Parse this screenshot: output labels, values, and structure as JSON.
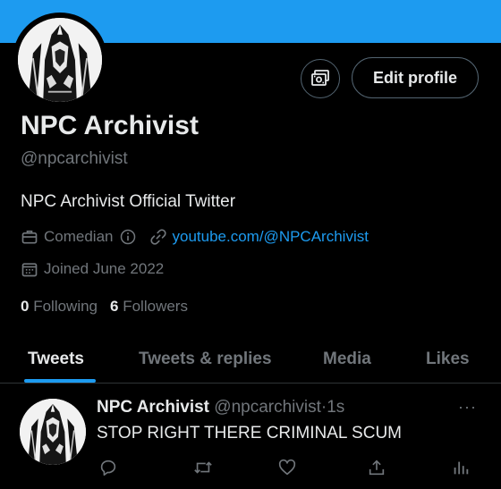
{
  "profile": {
    "name": "NPC Archivist",
    "handle": "@npcarchivist",
    "bio": "NPC Archivist Official Twitter",
    "category": "Comedian",
    "link": "youtube.com/@NPCArchivist",
    "joined": "Joined June 2022",
    "following_count": "0",
    "following_label": "Following",
    "followers_count": "6",
    "followers_label": "Followers"
  },
  "buttons": {
    "edit_profile": "Edit profile"
  },
  "tabs": [
    {
      "label": "Tweets",
      "active": true
    },
    {
      "label": "Tweets & replies",
      "active": false
    },
    {
      "label": "Media",
      "active": false
    },
    {
      "label": "Likes",
      "active": false
    }
  ],
  "tweet": {
    "author": "NPC Archivist",
    "handle": "@npcarchivist",
    "separator": "·",
    "time": "1s",
    "text": "STOP RIGHT THERE CRIMINAL SCUM",
    "more": "···"
  },
  "icons": {
    "banner_color": "#1d9bf0",
    "accent": "#1d9bf0",
    "category_icon": "briefcase-icon",
    "info_icon": "info-icon",
    "link_icon": "link-icon",
    "calendar_icon": "calendar-icon",
    "professional_icon": "money-icon"
  }
}
